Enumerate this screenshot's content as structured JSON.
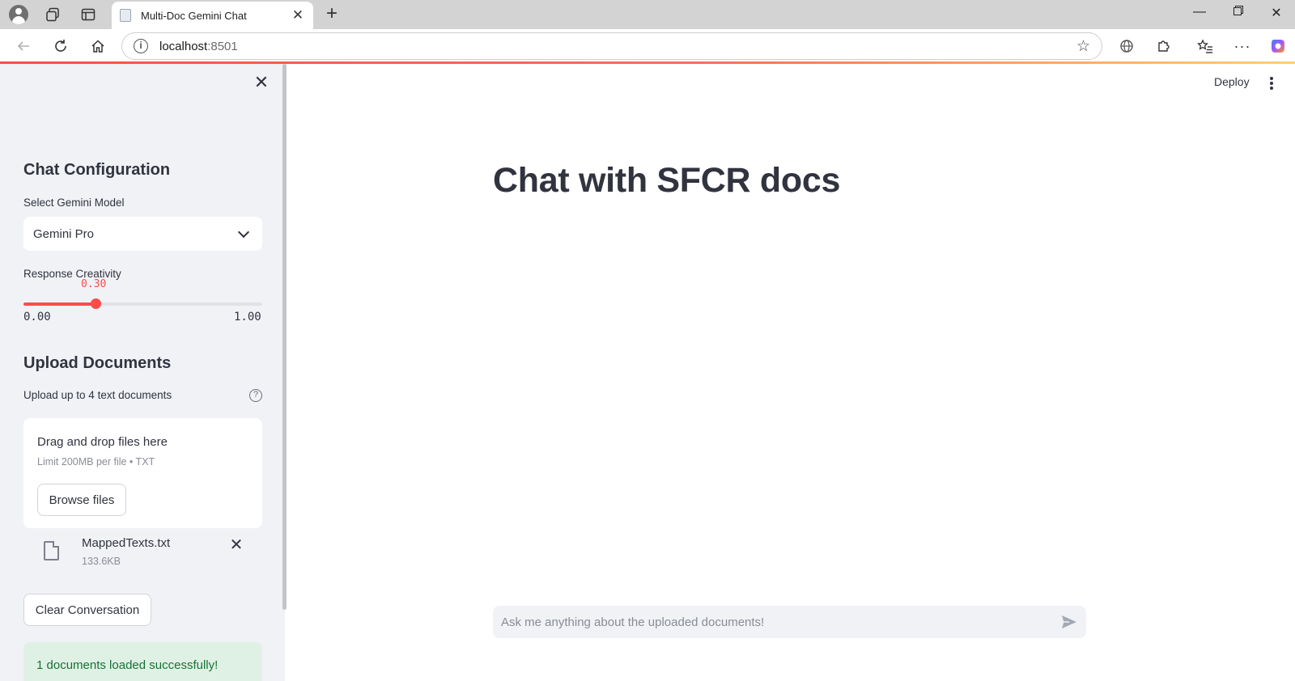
{
  "browser": {
    "tab_title": "Multi-Doc Gemini Chat",
    "url_host": "localhost",
    "url_port": ":8501"
  },
  "sidebar": {
    "config_heading": "Chat Configuration",
    "model_label": "Select Gemini Model",
    "model_value": "Gemini Pro",
    "creativity_label": "Response Creativity",
    "creativity_value": "0.30",
    "creativity_fraction": 0.3,
    "creativity_min": "0.00",
    "creativity_max": "1.00",
    "upload_heading": "Upload Documents",
    "upload_label": "Upload up to 4 text documents",
    "help_glyph": "?",
    "dropzone_title": "Drag and drop files here",
    "dropzone_limit": "Limit 200MB per file • TXT",
    "browse_label": "Browse files",
    "file": {
      "name": "MappedTexts.txt",
      "size": "133.6KB"
    },
    "clear_label": "Clear Conversation",
    "success_message": "1 documents loaded successfully!"
  },
  "main": {
    "deploy_label": "Deploy",
    "title": "Chat with SFCR docs",
    "chat_placeholder": "Ask me anything about the uploaded documents!"
  },
  "colors": {
    "accent": "#ff4b4b",
    "sidebar_bg": "#f0f2f6",
    "text": "#31333f",
    "success_bg": "#dff1e5",
    "success_text": "#177233"
  }
}
